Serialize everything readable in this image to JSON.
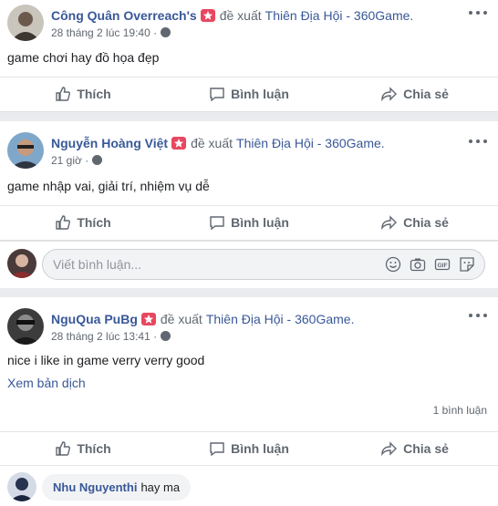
{
  "posts": [
    {
      "author": "Công Quân Overreach's",
      "verb": "đề xuất",
      "page": "Thiên Địa Hội - 360Game.",
      "time": "28 tháng 2 lúc 19:40 ·",
      "text": "game chơi hay đồ họa đẹp"
    },
    {
      "author": "Nguyễn Hoàng Việt",
      "verb": "đề xuất",
      "page": "Thiên Địa Hội - 360Game.",
      "time": "21 giờ ·",
      "text": "game nhập vai, giải trí, nhiệm vụ dễ"
    },
    {
      "author": "NguQua PuBg",
      "verb": "đề xuất",
      "page": "Thiên Địa Hội - 360Game.",
      "time": "28 tháng 2 lúc 13:41 ·",
      "text": "nice i like in game verry verry good",
      "translate": "Xem bản dịch",
      "comment_count": "1 bình luận"
    }
  ],
  "actions": {
    "like": "Thích",
    "comment": "Bình luận",
    "share": "Chia sẻ"
  },
  "comment_input": {
    "placeholder": "Viết bình luận..."
  },
  "reply": {
    "name": "Nhu Nguyenthi",
    "text": "hay ma"
  },
  "icons": [
    "badge-icon",
    "globe-icon",
    "more-icon",
    "like-icon",
    "comment-icon",
    "share-icon",
    "emoji-icon",
    "camera-icon",
    "gif-icon",
    "sticker-icon"
  ],
  "colors": {
    "link": "#385898",
    "badge": "#e8475f",
    "muted": "#606770"
  }
}
